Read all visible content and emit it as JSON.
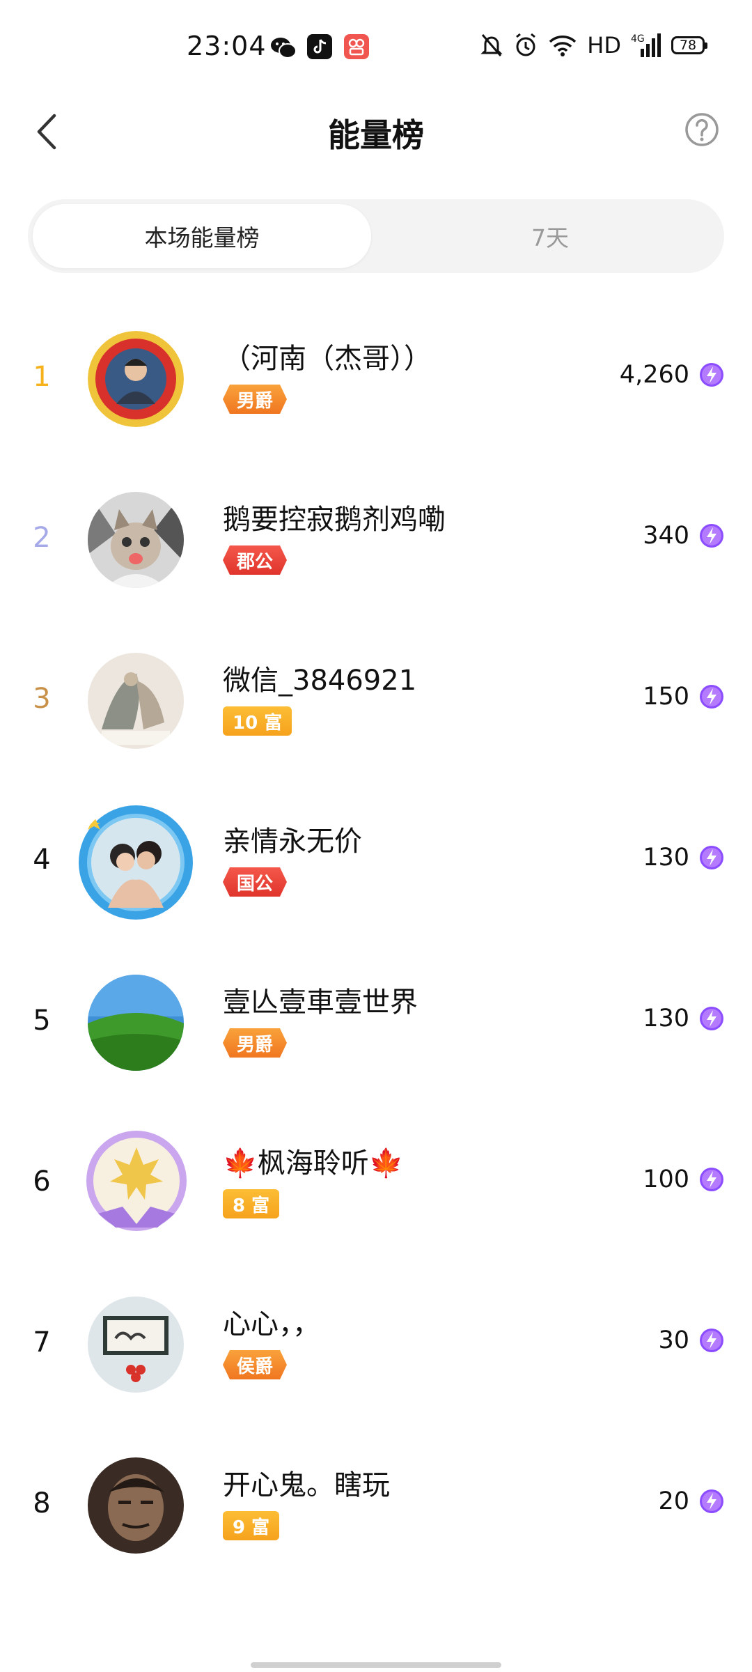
{
  "status_bar": {
    "time": "23:04",
    "network_label": "HD",
    "network_type": "4G",
    "battery": "78"
  },
  "header": {
    "title": "能量榜"
  },
  "tabs": [
    {
      "label": "本场能量榜",
      "active": true
    },
    {
      "label": "7天",
      "active": false
    }
  ],
  "leaderboard": [
    {
      "rank": "1",
      "name": "（河南（杰哥））",
      "badge": "男爵",
      "badge_type": "title",
      "score": "4,260"
    },
    {
      "rank": "2",
      "name": "鹅要控寂鹅剂鸡嘞",
      "badge": "郡公",
      "badge_type": "title-red",
      "score": "340"
    },
    {
      "rank": "3",
      "name": "微信_3846921",
      "badge": "10 富",
      "badge_type": "rich",
      "score": "150"
    },
    {
      "rank": "4",
      "name": "亲情永无价",
      "badge": "国公",
      "badge_type": "title-red",
      "score": "130"
    },
    {
      "rank": "5",
      "name": "壹亾壹車壹世界",
      "badge": "男爵",
      "badge_type": "title",
      "score": "130"
    },
    {
      "rank": "6",
      "name": "🍁枫海聆听🍁",
      "badge": "8 富",
      "badge_type": "rich",
      "score": "100"
    },
    {
      "rank": "7",
      "name": "心心，，",
      "badge": "侯爵",
      "badge_type": "title",
      "score": "30"
    },
    {
      "rank": "8",
      "name": "开心鬼。瞎玩",
      "badge": "9 富",
      "badge_type": "rich",
      "score": "20"
    }
  ],
  "colors": {
    "rank1": "#f5b21b",
    "rank2": "#a5a9e8",
    "rank3": "#c89147",
    "energy": "#8b4dff",
    "badge_orange": "#f58a28",
    "badge_red": "#e83d31",
    "badge_gold": "#f8ad26"
  }
}
